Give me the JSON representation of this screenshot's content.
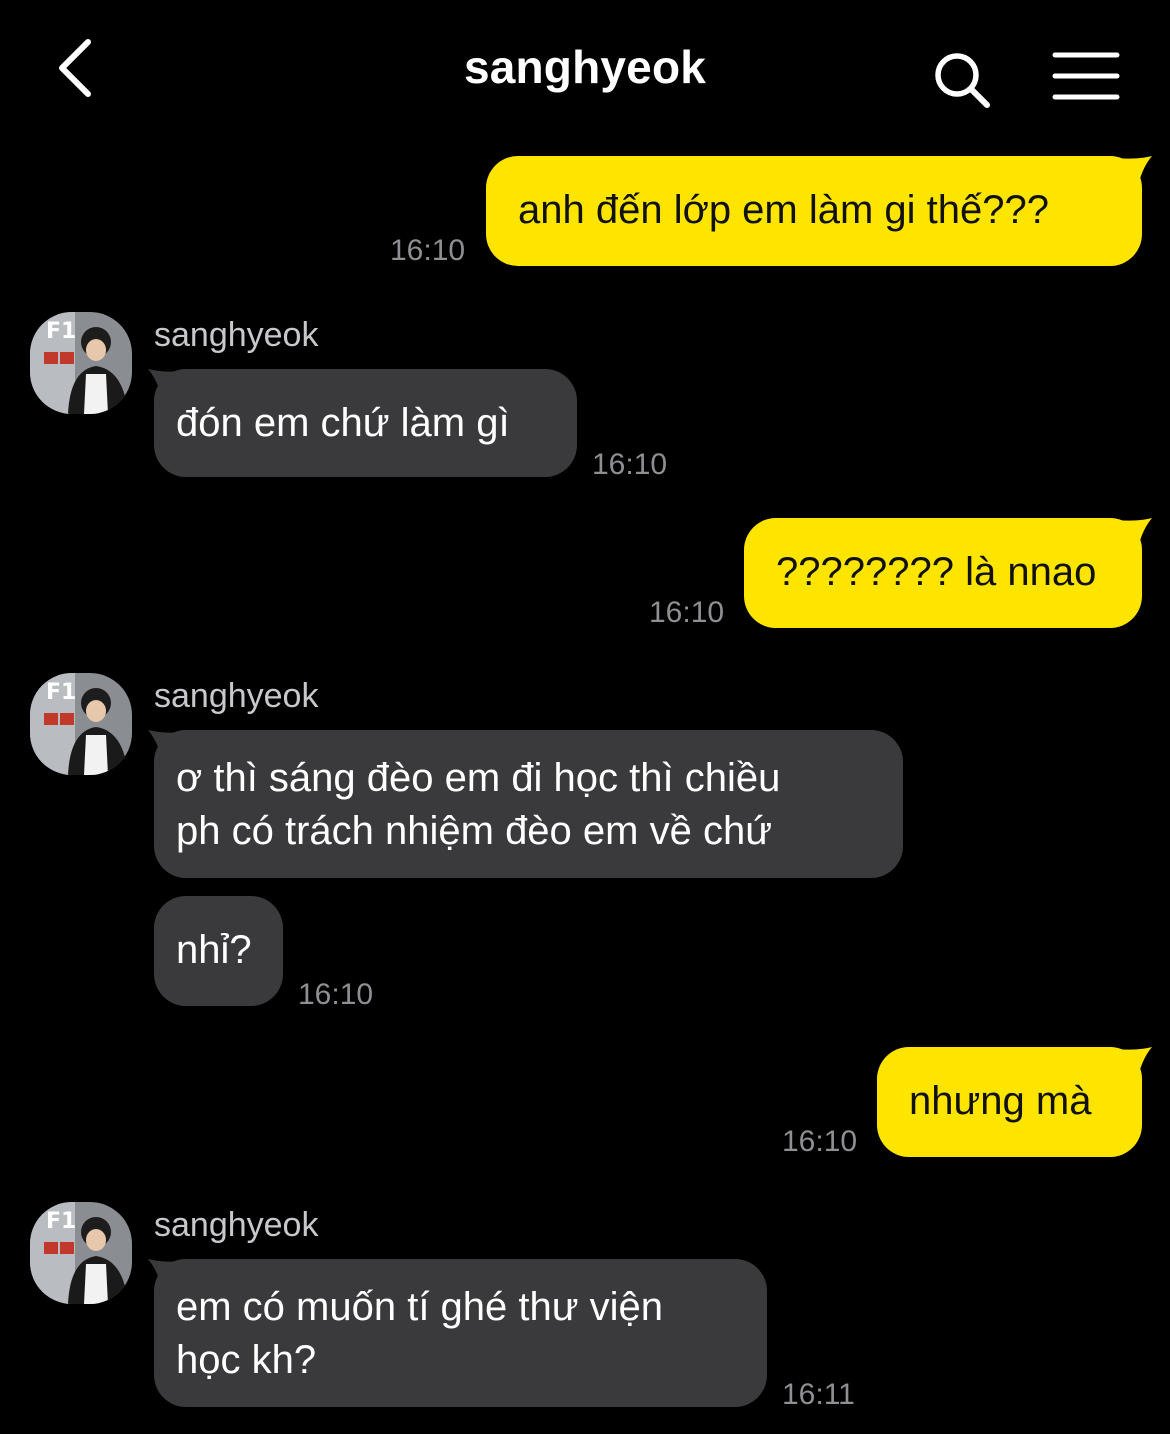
{
  "header": {
    "title": "sanghyeok",
    "back_icon": "chevron-left-icon",
    "search_icon": "search-icon",
    "menu_icon": "menu-icon"
  },
  "colors": {
    "background": "#000000",
    "my_bubble": "#fee500",
    "their_bubble": "#3a3a3c",
    "time_text": "#8e8e93"
  },
  "messages": [
    {
      "from": "me",
      "text": "anh đến lớp em làm gi thế???",
      "time": "16:10"
    },
    {
      "from": "sanghyeok",
      "sender": "sanghyeok",
      "text": "đón em chứ làm gì",
      "time": "16:10"
    },
    {
      "from": "me",
      "text": "???????? là nnao",
      "time": "16:10"
    },
    {
      "from": "sanghyeok",
      "sender": "sanghyeok",
      "lines": [
        "ơ thì sáng đèo em đi học thì chiều",
        "ph có trách nhiệm đèo em về chứ"
      ]
    },
    {
      "from": "sanghyeok",
      "text": "nhỉ?",
      "time": "16:10"
    },
    {
      "from": "me",
      "text": "nhưng mà",
      "time": "16:10"
    },
    {
      "from": "sanghyeok",
      "sender": "sanghyeok",
      "lines": [
        "em có muốn tí ghé thư viện",
        "học kh?"
      ],
      "time": "16:11"
    }
  ]
}
